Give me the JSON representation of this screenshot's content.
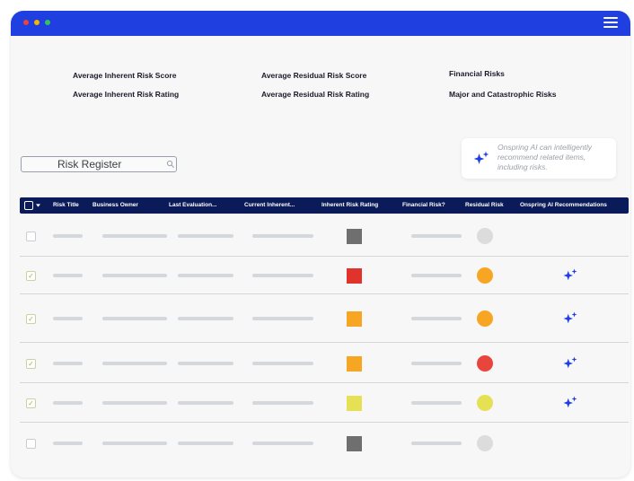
{
  "colors": {
    "titlebar": "#1f3fe0",
    "header_bg": "#0b1a59",
    "accent": "#1f3fe0",
    "window_dots": [
      "#e8453c",
      "#f6b500",
      "#32c35a"
    ]
  },
  "metrics": [
    "Average Inherent Risk Score",
    "Average Inherent Risk Rating",
    "Average Residual Risk Score",
    "Average Residual Risk Rating",
    "Financial Risks",
    "Major and Catastrophic Risks"
  ],
  "search": {
    "placeholder": "Risk Register",
    "icon": "search-icon"
  },
  "ai_card": {
    "icon": "sparkle-icon",
    "text": "Onspring AI can intelligently recommend related items, including risks."
  },
  "table": {
    "columns": [
      "Risk Title",
      "Business Owner",
      "Last Evaluation...",
      "Current Inherent...",
      "Inherent Risk Rating",
      "Financial Risk?",
      "Residual Risk",
      "Onspring AI Recommendations"
    ],
    "rows": [
      {
        "checked": false,
        "inherent_color": "#6f6f6f",
        "residual_color": "#dcdcdc",
        "ai_recommendation": false
      },
      {
        "checked": true,
        "inherent_color": "#e0332b",
        "residual_color": "#f6a623",
        "ai_recommendation": true
      },
      {
        "checked": true,
        "inherent_color": "#f6a623",
        "residual_color": "#f6a623",
        "ai_recommendation": true
      },
      {
        "checked": true,
        "inherent_color": "#f6a623",
        "residual_color": "#e8453c",
        "ai_recommendation": true
      },
      {
        "checked": true,
        "inherent_color": "#e6e055",
        "residual_color": "#e6e055",
        "ai_recommendation": true
      },
      {
        "checked": false,
        "inherent_color": "#6f6f6f",
        "residual_color": "#dcdcdc",
        "ai_recommendation": false
      }
    ]
  }
}
